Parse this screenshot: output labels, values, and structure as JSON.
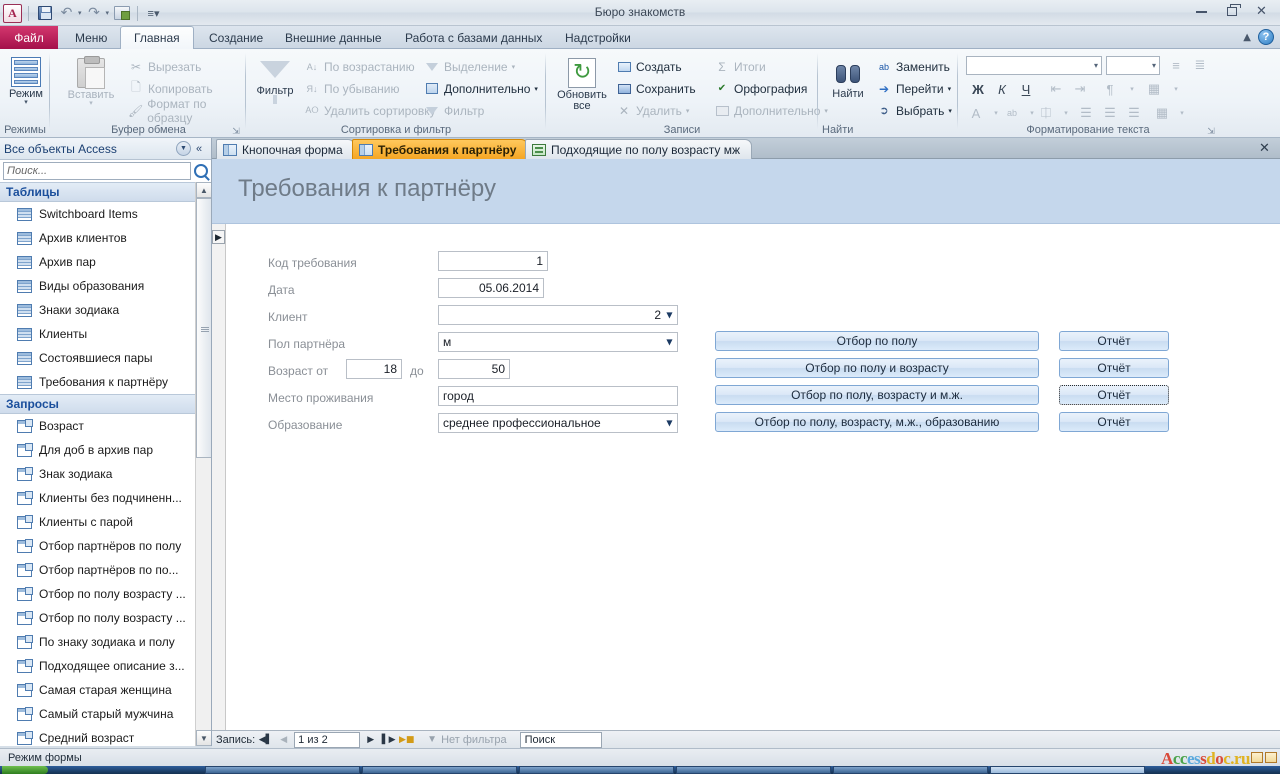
{
  "window": {
    "title": "Бюро знакомств",
    "app_icon": "A",
    "controls": {
      "minimize": "minimize-icon",
      "restore": "restore-icon",
      "close": "close-icon"
    }
  },
  "quick_access": {
    "items": [
      {
        "name": "save-icon",
        "label": "Сохранить"
      },
      {
        "name": "undo-icon",
        "label": "Отменить"
      },
      {
        "name": "redo-icon",
        "label": "Вернуть"
      },
      {
        "name": "print-preview-icon",
        "label": "Предварительный просмотр"
      },
      {
        "name": "customize-qat-icon",
        "label": "Настройка панели быстрого доступа"
      }
    ]
  },
  "ribbon": {
    "file_tab": "Файл",
    "tabs": [
      {
        "label": "Меню",
        "active": false
      },
      {
        "label": "Главная",
        "active": true
      },
      {
        "label": "Создание",
        "active": false
      },
      {
        "label": "Внешние данные",
        "active": false
      },
      {
        "label": "Работа с базами данных",
        "active": false
      },
      {
        "label": "Надстройки",
        "active": false
      }
    ],
    "groups": {
      "views": {
        "label": "Режимы",
        "big_button": "Режим"
      },
      "clipboard": {
        "label": "Буфер обмена",
        "paste": "Вставить",
        "items": [
          "Вырезать",
          "Копировать",
          "Формат по образцу"
        ]
      },
      "sort_filter": {
        "label": "Сортировка и фильтр",
        "filter": "Фильтр",
        "items": [
          "По возрастанию",
          "По убыванию",
          "Удалить сортировку"
        ],
        "items2": [
          "Выделение",
          "Дополнительно",
          "Фильтр"
        ]
      },
      "records": {
        "label": "Записи",
        "refresh": "Обновить все",
        "items": [
          "Создать",
          "Сохранить",
          "Удалить"
        ],
        "items2": [
          "Итоги",
          "Орфография",
          "Дополнительно"
        ]
      },
      "find": {
        "label": "Найти",
        "find": "Найти",
        "items": [
          "Заменить",
          "Перейти",
          "Выбрать"
        ]
      },
      "text_format": {
        "label": "Форматирование текста",
        "font_value": "",
        "size_value": "",
        "bold": "Ж",
        "italic": "К",
        "underline": "Ч"
      }
    }
  },
  "nav_pane": {
    "title": "Все объекты Access",
    "search_placeholder": "Поиск...",
    "groups": [
      {
        "label": "Таблицы",
        "icon": "table-icon",
        "items": [
          "Switchboard Items",
          "Архив клиентов",
          "Архив пар",
          "Виды образования",
          "Знаки зодиака",
          "Клиенты",
          "Состоявшиеся пары",
          "Требования к партнёру"
        ]
      },
      {
        "label": "Запросы",
        "icon": "query-icon",
        "items": [
          "Возраст",
          "Для  доб в архив пар",
          "Знак зодиака",
          "Клиенты без подчиненн...",
          "Клиенты с парой",
          "Отбор партнёров по полу",
          "Отбор партнёров по по...",
          "Отбор по полу  возрасту ...",
          "Отбор по полу  возрасту ...",
          "По знаку зодиака и полу",
          "Подходящее описание з...",
          "Самая старая женщина",
          "Самый старый мужчина",
          "Средний возраст"
        ]
      }
    ]
  },
  "doc_tabs": [
    {
      "label": "Кнопочная форма",
      "icon": "form-icon",
      "active": false
    },
    {
      "label": "Требования к партнёру",
      "icon": "form-icon",
      "active": true
    },
    {
      "label": "Подходящие по полу возрасту мж",
      "icon": "report-icon",
      "active": false
    }
  ],
  "form": {
    "header_title": "Требования к партнёру",
    "fields": [
      {
        "name": "kod-trebovaniya",
        "label": "Код требования",
        "value": "1",
        "type": "number"
      },
      {
        "name": "data",
        "label": "Дата",
        "value": "05.06.2014",
        "type": "date"
      },
      {
        "name": "klient",
        "label": "Клиент",
        "value": "2",
        "type": "combo-number"
      },
      {
        "name": "pol-partnera",
        "label": "Пол партнёра",
        "value": "м",
        "type": "combo"
      },
      {
        "name": "vozrast",
        "label": "Возраст от",
        "value_from": "18",
        "mid_label": "до",
        "value_to": "50",
        "type": "range"
      },
      {
        "name": "mesto-prozhivaniya",
        "label": "Место проживания",
        "value": "город",
        "type": "text"
      },
      {
        "name": "obrazovanie",
        "label": "Образование",
        "value": "среднее профессиональное",
        "type": "combo"
      }
    ],
    "action_buttons": [
      {
        "label": "Отбор по полу",
        "report": "Отчёт",
        "report_focused": false
      },
      {
        "label": "Отбор по полу и возрасту",
        "report": "Отчёт",
        "report_focused": false
      },
      {
        "label": "Отбор по полу, возрасту и м.ж.",
        "report": "Отчёт",
        "report_focused": true
      },
      {
        "label": "Отбор по полу, возрасту, м.ж., образованию",
        "report": "Отчёт",
        "report_focused": false
      }
    ]
  },
  "record_nav": {
    "label": "Запись:",
    "position": "1 из 2",
    "filter_status": "Нет фильтра",
    "search_value": "Поиск"
  },
  "status_bar": {
    "mode": "Режим формы",
    "watermark": [
      "A",
      "c",
      "c",
      "e",
      "s",
      "s",
      "d",
      "o",
      "c",
      ".ru"
    ]
  },
  "colors": {
    "accent_orange": "#f5a623",
    "file_tab_red": "#a4104a",
    "form_header_blue": "#c5d7ec",
    "button_blue": "#dbe8f7"
  }
}
